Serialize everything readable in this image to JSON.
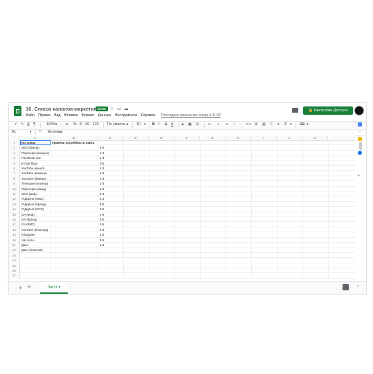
{
  "doc": {
    "title": "16. Список каналов маркетинга",
    "badge": "XLSX",
    "last_edit": "Последнее изменение: вчера в 11:02",
    "share_label": "Настройки Доступа"
  },
  "menu": [
    "Файл",
    "Правка",
    "Вид",
    "Вставка",
    "Формат",
    "Данные",
    "Инструменты",
    "Справка"
  ],
  "toolbar": {
    "zoom": "100%",
    "currency": "р.",
    "percent": "%",
    "dec_less": ".0",
    "dec_more": ".00",
    "format_123": "123",
    "font": "По умолча...",
    "font_size": "10",
    "bold": "B",
    "italic": "I",
    "strike": "S",
    "text_color": "A"
  },
  "formula": {
    "cell_ref": "A1",
    "fx": "fx",
    "content": "Источник"
  },
  "columns": [
    "A",
    "B",
    "C",
    "D",
    "E",
    "F",
    "G",
    "H",
    "I",
    "J",
    "K"
  ],
  "sheet": {
    "header": [
      "Источник",
      "Уровень потребности Ханта"
    ],
    "rows": [
      [
        "SEO (бренд)",
        "4-5"
      ],
      [
        "Партнерки (выпуск)",
        "1-3"
      ],
      [
        "Facebook Inst",
        "1-3"
      ],
      [
        "E-mail база",
        "3-5"
      ],
      [
        "YouTube (канал)",
        "1-3"
      ],
      [
        "YouTube (превью)",
        "1-3"
      ],
      [
        "YouTube (баннер)",
        "1-3"
      ],
      [
        "Телеграм (посевы)",
        "1-3"
      ],
      [
        "Партнерки (вход)",
        "1-3"
      ],
      [
        "SEO (инф.)",
        "2-3"
      ],
      [
        "Я.Директ (инф.)",
        "2-3"
      ],
      [
        "Я.Директ (бренд)",
        "4-5"
      ],
      [
        "Я.Директ (РСЯ)",
        "4-5"
      ],
      [
        "GA (инф)",
        "2-3"
      ],
      [
        "GA (бренд)",
        "4-5"
      ],
      [
        "GA (КМС)",
        "4-5"
      ],
      [
        "YouTube (блогеры)",
        "1-3"
      ],
      [
        "Instagram",
        "1-3"
      ],
      [
        "Чат-боты",
        "3-5"
      ],
      [
        "Дзен",
        "1-3"
      ],
      [
        "Дзен (платная)",
        ""
      ]
    ],
    "row_numbers": [
      "1",
      "2",
      "3",
      "4",
      "5",
      "6",
      "7",
      "8",
      "9",
      "10",
      "11",
      "12",
      "13",
      "14",
      "15",
      "16",
      "17",
      "18",
      "19",
      "20",
      "21",
      "22",
      "23",
      "24",
      "25",
      "26",
      "27"
    ]
  },
  "sheet_tab": "Лист1",
  "colors": {
    "accent": "#188038",
    "grid": "#e2e2e2"
  }
}
